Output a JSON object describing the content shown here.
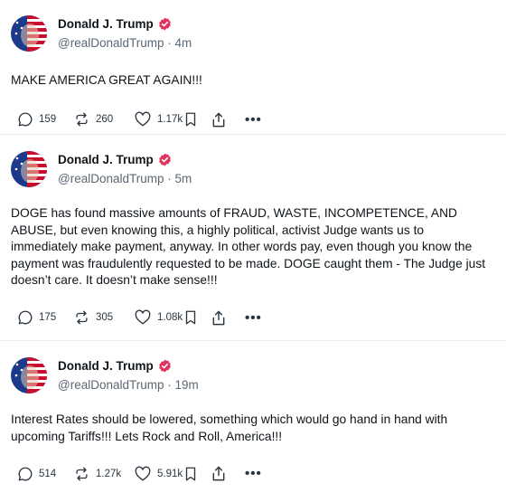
{
  "posts": [
    {
      "name": "Donald J. Trump",
      "handle": "@realDonaldTrump",
      "sep": "·",
      "time": "4m",
      "text": "MAKE AMERICA GREAT AGAIN!!!",
      "replies": "159",
      "reposts": "260",
      "likes": "1.17k"
    },
    {
      "name": "Donald J. Trump",
      "handle": "@realDonaldTrump",
      "sep": "·",
      "time": "5m",
      "text": "DOGE has found massive amounts of FRAUD, WASTE, INCOMPETENCE, AND ABUSE, but even knowing this, a highly political, activist Judge wants us to immediately make payment, anyway. In other words pay, even though you know the payment was fraudulently requested to be made. DOGE caught them - The Judge just doesn’t care. It doesn’t make sense!!!",
      "replies": "175",
      "reposts": "305",
      "likes": "1.08k"
    },
    {
      "name": "Donald J. Trump",
      "handle": "@realDonaldTrump",
      "sep": "·",
      "time": "19m",
      "text": "Interest Rates should be lowered, something which would go hand in hand with upcoming Tariffs!!! Lets Rock and Roll, America!!!",
      "replies": "514",
      "reposts": "1.27k",
      "likes": "5.91k"
    }
  ],
  "icons": {
    "verified": "verified-badge-icon",
    "reply": "comment-icon",
    "repost": "repost-icon",
    "like": "heart-icon",
    "bookmark": "bookmark-icon",
    "share": "share-icon",
    "more": "more-icon"
  },
  "more_glyph": "•••",
  "colors": {
    "verified": "#e0345f",
    "muted": "#5b6773",
    "divider": "#eceef0"
  }
}
